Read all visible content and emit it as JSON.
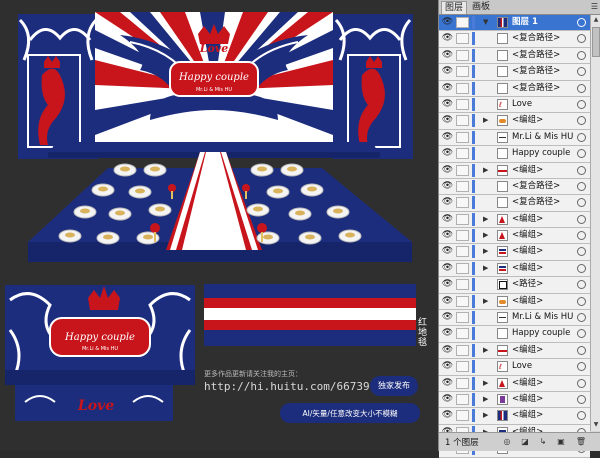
{
  "stage": {
    "banner_love": "Love",
    "banner_title": "Happy couple",
    "banner_sub": "Mr.Li & Mis HU"
  },
  "backdrop": {
    "love": "Love",
    "title": "Happy couple",
    "sub": "Mr.Li & Mis HU"
  },
  "carpet_label": "红地毯",
  "promo": {
    "note": "更多作品更新请关注我的主页：",
    "url": "http://hi.huitu.com/66739",
    "badge": "独家发布",
    "caption": "AI/矢量/任意改变大小不模糊"
  },
  "colors": {
    "navy": "#1d2d7e",
    "red": "#c8151c",
    "white": "#ffffff",
    "selection": "#3874d0"
  },
  "panel": {
    "tab_layers": "图层",
    "tab_artboards": "画板",
    "footer_count": "1 个图层",
    "layers": [
      {
        "label": "图层 1",
        "selected": true,
        "expand": "▼",
        "thumb": "scene"
      },
      {
        "label": "<复合路径>",
        "expand": "",
        "thumb": "blank"
      },
      {
        "label": "<复合路径>",
        "expand": "",
        "thumb": "blank"
      },
      {
        "label": "<复合路径>",
        "expand": "",
        "thumb": "blank"
      },
      {
        "label": "<复合路径>",
        "expand": "",
        "thumb": "blank"
      },
      {
        "label": "Love",
        "expand": "",
        "thumb": "love"
      },
      {
        "label": "<编组>",
        "expand": "▶",
        "thumb": "group"
      },
      {
        "label": "Mr.Li & Mis HU",
        "expand": "",
        "thumb": "text"
      },
      {
        "label": "Happy couple",
        "expand": "",
        "thumb": "blank"
      },
      {
        "label": "<编组>",
        "expand": "▶",
        "thumb": "redline"
      },
      {
        "label": "<复合路径>",
        "expand": "",
        "thumb": "blank"
      },
      {
        "label": "<复合路径>",
        "expand": "",
        "thumb": "blank"
      },
      {
        "label": "<编组>",
        "expand": "▶",
        "thumb": "triangle"
      },
      {
        "label": "<编组>",
        "expand": "▶",
        "thumb": "triangle"
      },
      {
        "label": "<编组>",
        "expand": "▶",
        "thumb": "bar"
      },
      {
        "label": "<编组>",
        "expand": "▶",
        "thumb": "bar"
      },
      {
        "label": "<路径>",
        "expand": "",
        "thumb": "square"
      },
      {
        "label": "<编组>",
        "expand": "▶",
        "thumb": "group"
      },
      {
        "label": "Mr.Li & Mis HU",
        "expand": "",
        "thumb": "text"
      },
      {
        "label": "Happy couple",
        "expand": "",
        "thumb": "blank"
      },
      {
        "label": "<编组>",
        "expand": "▶",
        "thumb": "redline"
      },
      {
        "label": "Love",
        "expand": "",
        "thumb": "love"
      },
      {
        "label": "<编组>",
        "expand": "▶",
        "thumb": "triangle"
      },
      {
        "label": "<编组>",
        "expand": "▶",
        "thumb": "figure"
      },
      {
        "label": "<编组>",
        "expand": "▶",
        "thumb": "scene"
      },
      {
        "label": "<编组>",
        "expand": "▶",
        "thumb": "bar"
      },
      {
        "label": "<路径>",
        "expand": "",
        "thumb": "blank"
      }
    ]
  }
}
